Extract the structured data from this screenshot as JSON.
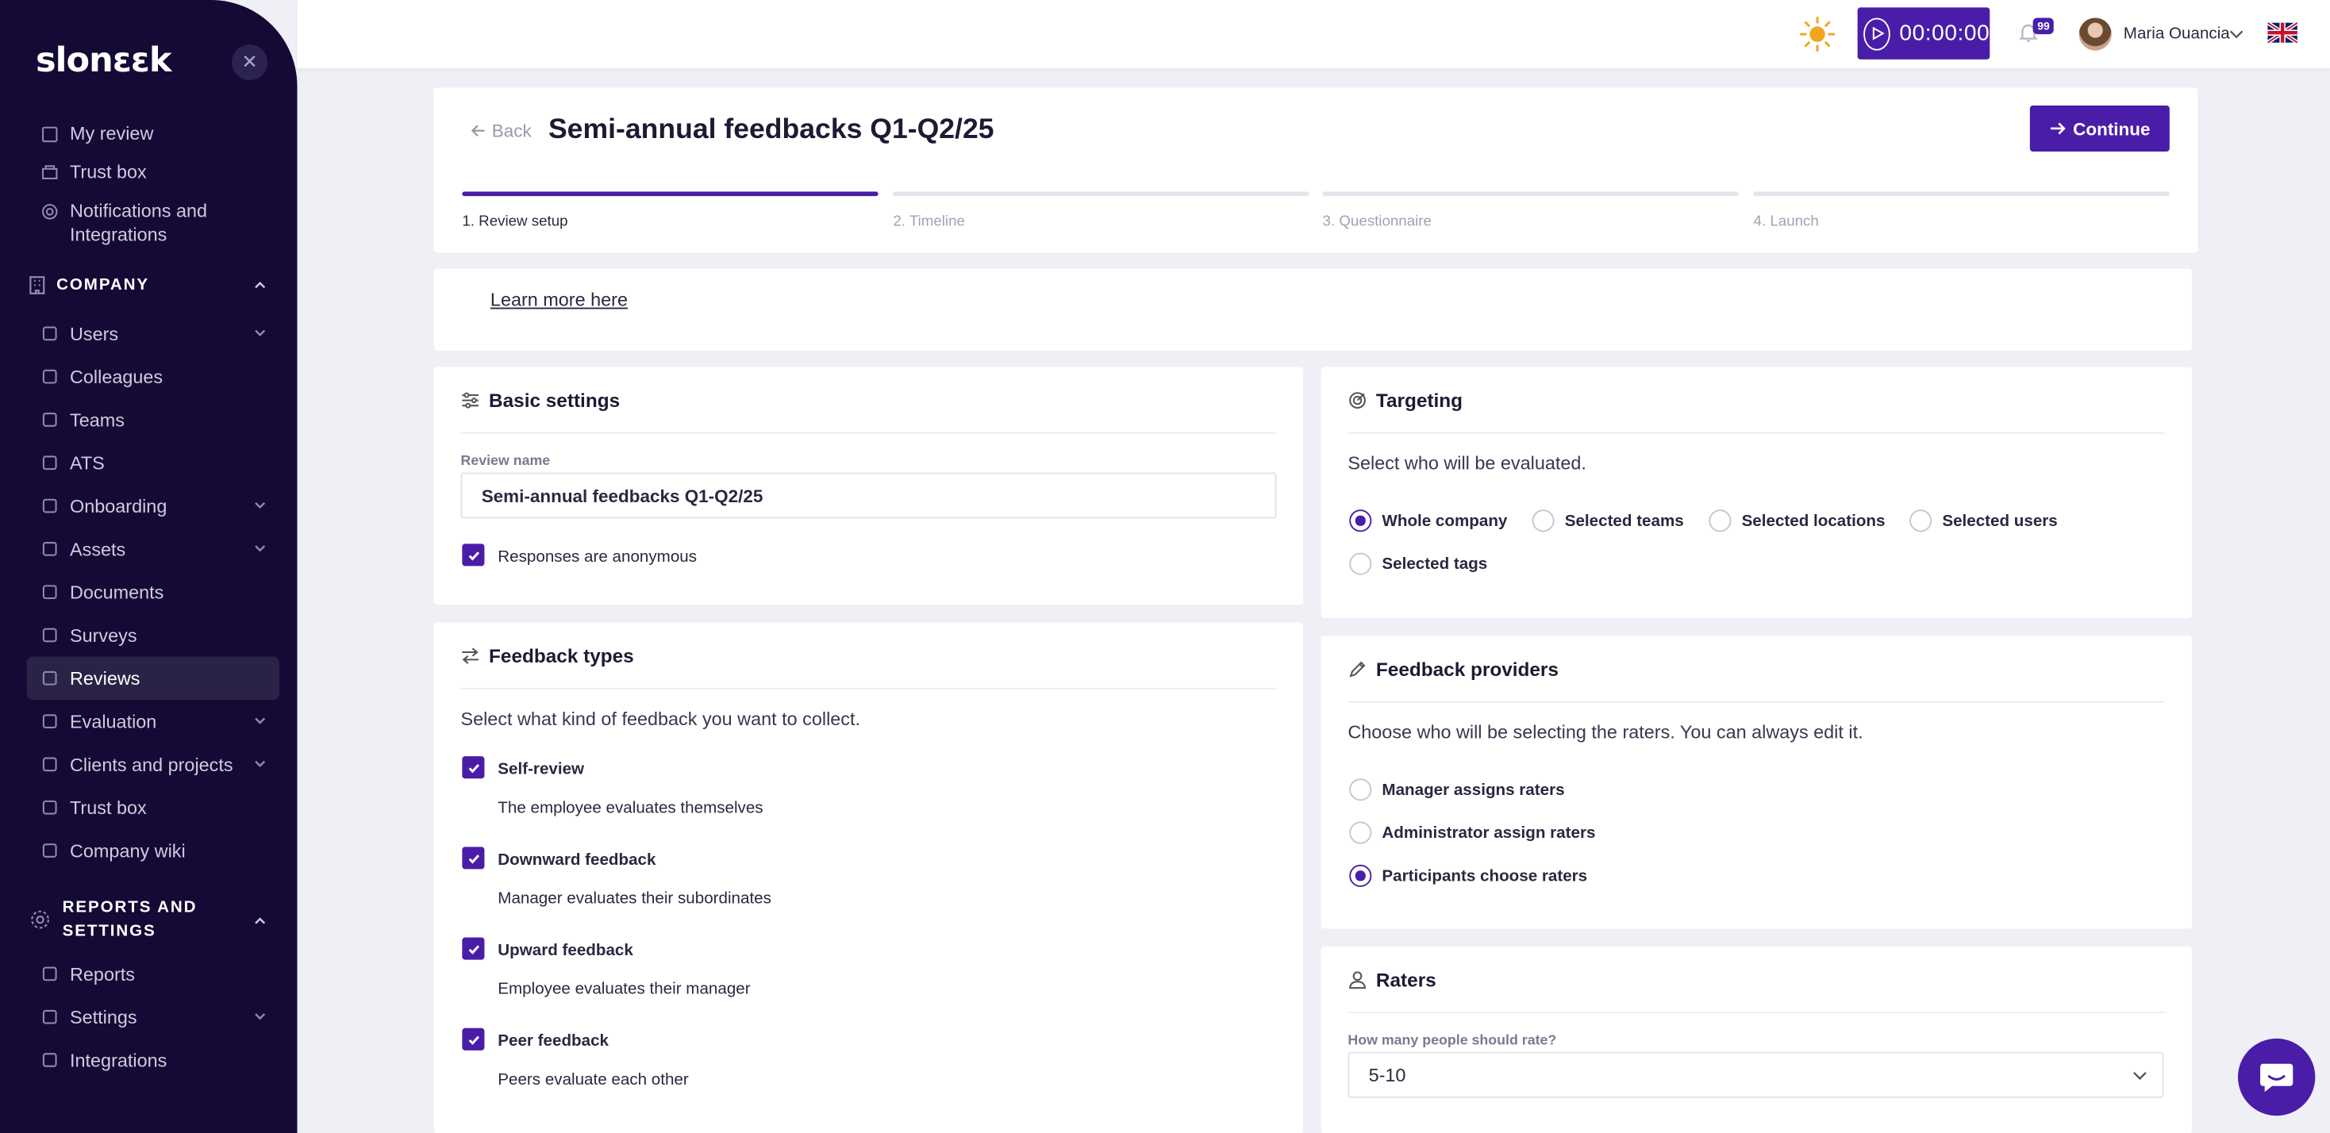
{
  "sidebar": {
    "logo": "slonεεk",
    "items_top": [
      {
        "label": "My review",
        "icon": "review-icon"
      },
      {
        "label": "Trust box",
        "icon": "trust-box-icon"
      },
      {
        "label": "Notifications and Integrations",
        "icon": "gear-icon"
      }
    ],
    "company_section": "COMPANY",
    "company_items": [
      {
        "label": "Users",
        "icon": "users-icon",
        "expandable": true
      },
      {
        "label": "Colleagues",
        "icon": "colleagues-icon"
      },
      {
        "label": "Teams",
        "icon": "teams-icon"
      },
      {
        "label": "ATS",
        "icon": "ats-icon"
      },
      {
        "label": "Onboarding",
        "icon": "onboarding-icon",
        "expandable": true
      },
      {
        "label": "Assets",
        "icon": "assets-icon",
        "expandable": true
      },
      {
        "label": "Documents",
        "icon": "folder-icon"
      },
      {
        "label": "Surveys",
        "icon": "surveys-icon"
      },
      {
        "label": "Reviews",
        "icon": "reviews-icon",
        "active": true
      },
      {
        "label": "Evaluation",
        "icon": "evaluation-icon",
        "expandable": true
      },
      {
        "label": "Clients and projects",
        "icon": "clients-icon",
        "expandable": true
      },
      {
        "label": "Trust box",
        "icon": "trust-box-icon"
      },
      {
        "label": "Company wiki",
        "icon": "wiki-icon"
      }
    ],
    "reports_section": "REPORTS AND SETTINGS",
    "reports_items": [
      {
        "label": "Reports",
        "icon": "chart-icon"
      },
      {
        "label": "Settings",
        "icon": "gear-icon",
        "expandable": true
      },
      {
        "label": "Integrations",
        "icon": "integrations-icon"
      }
    ]
  },
  "topbar": {
    "timer": "00:00:00",
    "notification_count": "99",
    "user_name": "Maria Ouancia",
    "language": "English (UK)"
  },
  "header": {
    "back_label": "Back",
    "title": "Semi-annual feedbacks Q1-Q2/25",
    "continue_label": "Continue",
    "steps": [
      {
        "label": "1. Review setup",
        "active": true
      },
      {
        "label": "2. Timeline",
        "active": false
      },
      {
        "label": "3. Questionnaire",
        "active": false
      },
      {
        "label": "4. Launch",
        "active": false
      }
    ]
  },
  "learn_more": "Learn more here",
  "basic_settings": {
    "title": "Basic settings",
    "review_name_label": "Review name",
    "review_name_value": "Semi-annual feedbacks Q1-Q2/25",
    "anonymous_label": "Responses are anonymous",
    "anonymous_checked": true
  },
  "feedback_types": {
    "title": "Feedback types",
    "description": "Select what kind of feedback you want to collect.",
    "items": [
      {
        "label": "Self-review",
        "desc": "The employee evaluates themselves",
        "checked": true
      },
      {
        "label": "Downward feedback",
        "desc": "Manager evaluates their subordinates",
        "checked": true
      },
      {
        "label": "Upward feedback",
        "desc": "Employee evaluates their manager",
        "checked": true
      },
      {
        "label": "Peer feedback",
        "desc": "Peers evaluate each other",
        "checked": true
      }
    ]
  },
  "targeting": {
    "title": "Targeting",
    "description": "Select who will be evaluated.",
    "options": [
      {
        "label": "Whole company",
        "selected": true
      },
      {
        "label": "Selected teams",
        "selected": false
      },
      {
        "label": "Selected locations",
        "selected": false
      },
      {
        "label": "Selected users",
        "selected": false
      },
      {
        "label": "Selected tags",
        "selected": false
      }
    ]
  },
  "providers": {
    "title": "Feedback providers",
    "description": "Choose who will be selecting the raters. You can always edit it.",
    "options": [
      {
        "label": "Manager assigns raters",
        "selected": false
      },
      {
        "label": "Administrator assign raters",
        "selected": false
      },
      {
        "label": "Participants choose raters",
        "selected": true
      }
    ]
  },
  "raters": {
    "title": "Raters",
    "question": "How many people should rate?",
    "value": "5-10"
  },
  "colors": {
    "accent": "#4a1da8",
    "sidebar": "#140a35",
    "background": "#eef0f6"
  }
}
